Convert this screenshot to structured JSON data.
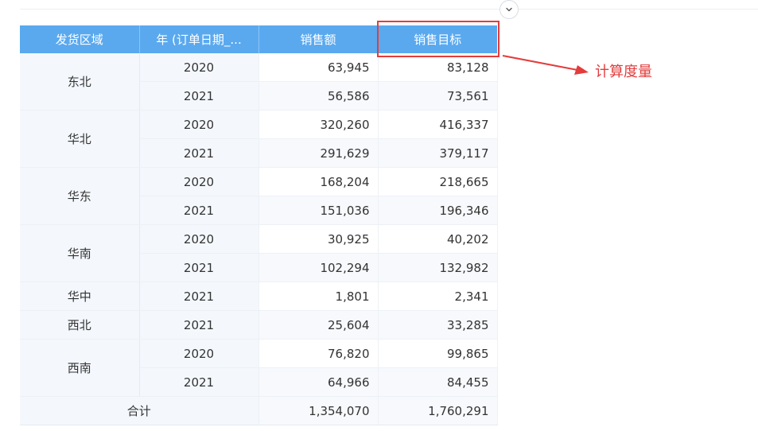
{
  "table": {
    "headers": [
      "发货区域",
      "年 (订单日期_...",
      "销售额",
      "销售目标"
    ],
    "regions": [
      {
        "name": "东北",
        "rows": [
          {
            "year": "2020",
            "sales": "63,945",
            "target": "83,128"
          },
          {
            "year": "2021",
            "sales": "56,586",
            "target": "73,561"
          }
        ]
      },
      {
        "name": "华北",
        "rows": [
          {
            "year": "2020",
            "sales": "320,260",
            "target": "416,337"
          },
          {
            "year": "2021",
            "sales": "291,629",
            "target": "379,117"
          }
        ]
      },
      {
        "name": "华东",
        "rows": [
          {
            "year": "2020",
            "sales": "168,204",
            "target": "218,665"
          },
          {
            "year": "2021",
            "sales": "151,036",
            "target": "196,346"
          }
        ]
      },
      {
        "name": "华南",
        "rows": [
          {
            "year": "2020",
            "sales": "30,925",
            "target": "40,202"
          },
          {
            "year": "2021",
            "sales": "102,294",
            "target": "132,982"
          }
        ]
      },
      {
        "name": "华中",
        "rows": [
          {
            "year": "2021",
            "sales": "1,801",
            "target": "2,341"
          }
        ]
      },
      {
        "name": "西北",
        "rows": [
          {
            "year": "2021",
            "sales": "25,604",
            "target": "33,285"
          }
        ]
      },
      {
        "name": "西南",
        "rows": [
          {
            "year": "2020",
            "sales": "76,820",
            "target": "99,865"
          },
          {
            "year": "2021",
            "sales": "64,966",
            "target": "84,455"
          }
        ]
      }
    ],
    "total": {
      "label": "合计",
      "sales": "1,354,070",
      "target": "1,760,291"
    }
  },
  "annotation": {
    "label": "计算度量",
    "color": "#e43c3c"
  },
  "toggle": {
    "icon": "chevron-down-icon"
  },
  "colors": {
    "header_bg": "#5aa9ef",
    "header_text": "#ffffff",
    "dimension_bg": "#f4f8fd"
  }
}
